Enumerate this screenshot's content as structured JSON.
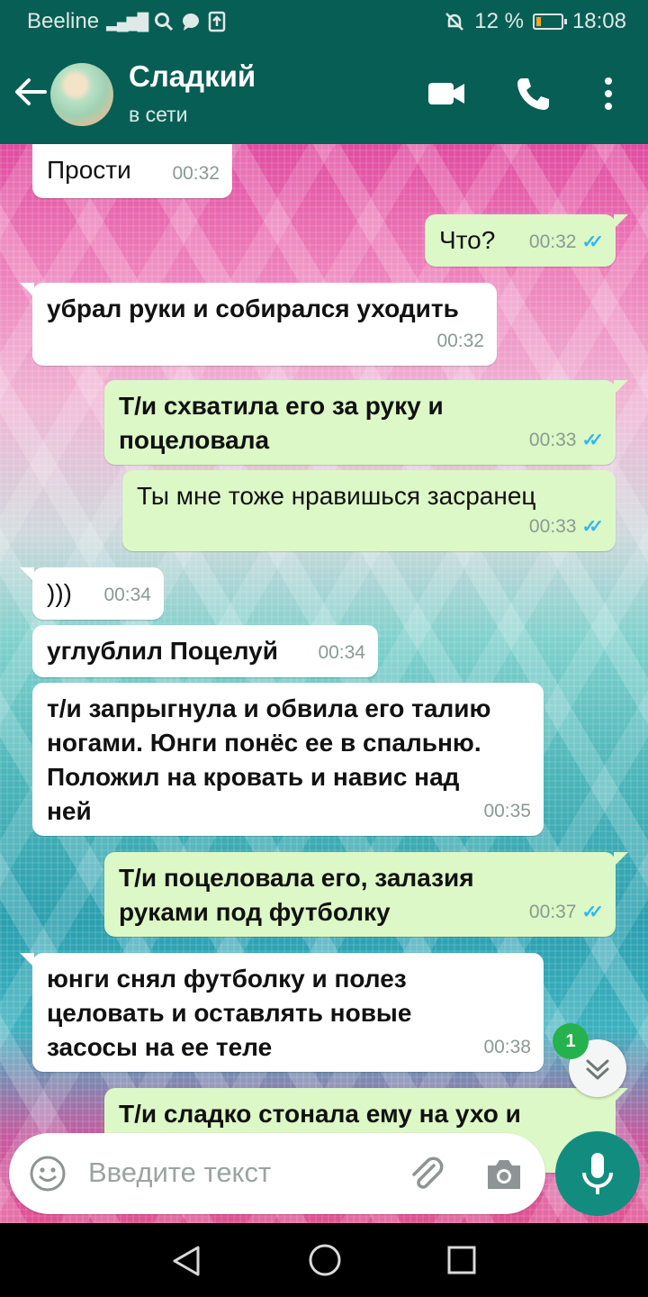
{
  "status_bar": {
    "carrier": "Beeline",
    "network": "4G",
    "battery": "12 %",
    "time": "18:08"
  },
  "header": {
    "contact_name": "Сладкий",
    "status": "в сети"
  },
  "messages": [
    {
      "dir": "in",
      "text": "Прости",
      "time": "00:32"
    },
    {
      "dir": "out",
      "text": "Что?",
      "time": "00:32"
    },
    {
      "dir": "in",
      "text": "убрал руки и собирался уходить",
      "time": "00:32"
    },
    {
      "dir": "out",
      "text": "Т/и схватила его за руку и\nпоцеловала",
      "time": "00:33"
    },
    {
      "dir": "out",
      "text": "Ты мне тоже нравишься засранец",
      "time": "00:33"
    },
    {
      "dir": "in",
      "text": ")))",
      "time": "00:34"
    },
    {
      "dir": "in",
      "text": "углублил Поцелуй",
      "time": "00:34"
    },
    {
      "dir": "in",
      "text": "т/и запрыгнула и обвила его талию\nногами. Юнги понёс ее в спальню.\nПоложил на кровать и навис над\nней",
      "time": "00:35"
    },
    {
      "dir": "out",
      "text": "Т/и поцеловала его, залазия\nруками под футболку",
      "time": "00:37"
    },
    {
      "dir": "in",
      "text": "юнги снял футболку и полез\nцеловать и оставлять новые\nзасосы на ее теле",
      "time": "00:38"
    },
    {
      "dir": "out",
      "text": "Т/и сладко стонала ему на ухо и",
      "time": ""
    }
  ],
  "unread_badge": "1",
  "composer": {
    "placeholder": "Введите текст"
  },
  "colors": {
    "header": "#075e54",
    "outgoing_bubble": "#dcf8c6",
    "incoming_bubble": "#ffffff",
    "accent": "#128c7e",
    "read_ticks": "#34b7f1"
  }
}
